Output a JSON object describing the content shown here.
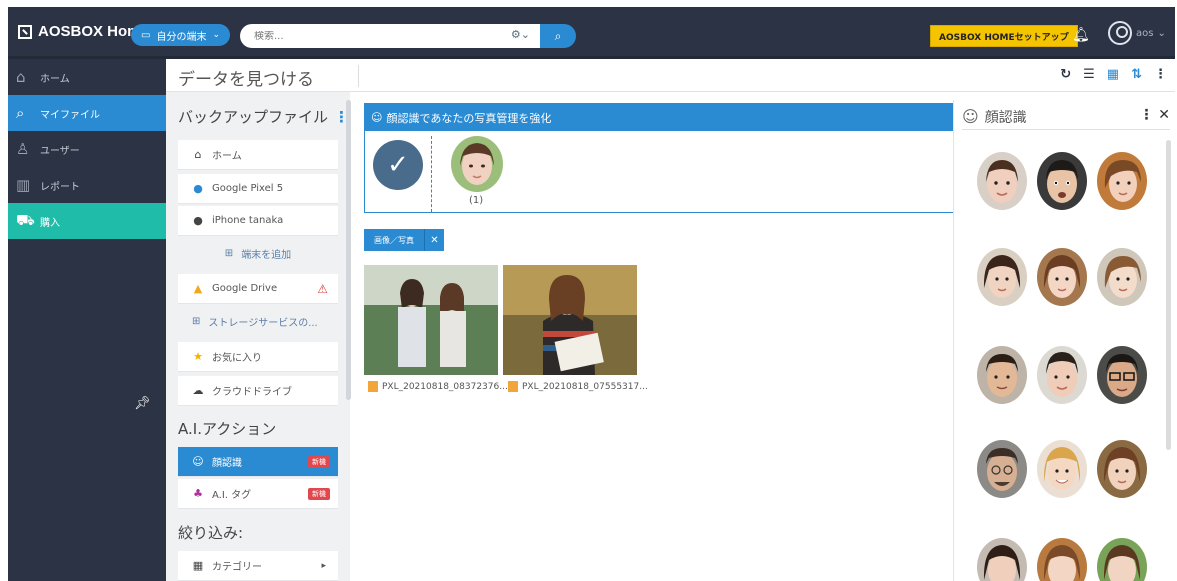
{
  "topbar": {
    "app_name": "AOSBOX Home",
    "device_selector": "自分の端末",
    "search_placeholder": "検索...",
    "setup_button": "AOSBOX HOMEセットアップ",
    "user_name": "aos"
  },
  "leftnav": {
    "items": [
      {
        "label": "ホーム",
        "icon": "home-icon"
      },
      {
        "label": "マイファイル",
        "icon": "search-icon"
      },
      {
        "label": "ユーザー",
        "icon": "user-icon"
      },
      {
        "label": "レポート",
        "icon": "report-icon"
      },
      {
        "label": "購入",
        "icon": "cart-icon"
      }
    ]
  },
  "page": {
    "title": "データを見つける"
  },
  "midpanel": {
    "backup_title": "バックアップファイル",
    "backup_items": [
      "ホーム",
      "Google Pixel 5",
      "iPhone tanaka"
    ],
    "add_device": "端末を追加",
    "google_drive": "Google Drive",
    "storage_service": "ストレージサービスの...",
    "favorites": "お気に入り",
    "cloud_drive": "クラウドドライブ",
    "ai_title": "A.I.アクション",
    "face_recognition": "顔認識",
    "ai_tag": "A.I. タグ",
    "new_badge": "新機",
    "filter_title": "絞り込み:",
    "category": "カテゴリー"
  },
  "main": {
    "banner_text": "顔認識であなたの写真管理を強化",
    "banner_count": "(1)",
    "filter_label": "画像／写真",
    "files": [
      {
        "name": "PXL_20210818_08372376..."
      },
      {
        "name": "PXL_20210818_07555317..."
      }
    ]
  },
  "facepanel": {
    "title": "顔認識"
  },
  "colors": {
    "topbar": "#2b3344",
    "accent": "#2a8bd3",
    "buy": "#1fbda9",
    "setup": "#f5c400",
    "badge": "#e0484e"
  }
}
